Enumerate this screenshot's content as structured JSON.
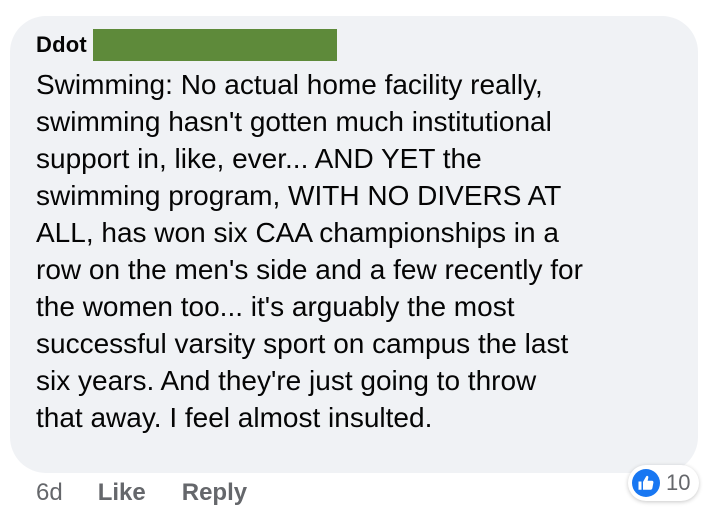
{
  "comment": {
    "author": "Ddot",
    "text_lines": [
      "Swimming: No actual home facility really,",
      "swimming hasn't gotten much institutional",
      "support in, like, ever... AND YET the",
      "swimming program, WITH NO DIVERS AT",
      "ALL, has won six CAA championships in a",
      "row on the men's side and a few recently for",
      "the women too... it's arguably the most",
      "successful varsity sport on campus the last",
      "six years. And they're just going to throw",
      "that away. I feel almost insulted."
    ],
    "redaction_color": "#5e8a3a"
  },
  "actions": {
    "timestamp": "6d",
    "like_label": "Like",
    "reply_label": "Reply"
  },
  "reactions": {
    "icon": "thumbs-up-icon",
    "count": "10",
    "accent_color": "#1877f2"
  },
  "colors": {
    "bubble_background": "#f0f2f5",
    "text": "#050505",
    "secondary_text": "#65676b"
  }
}
